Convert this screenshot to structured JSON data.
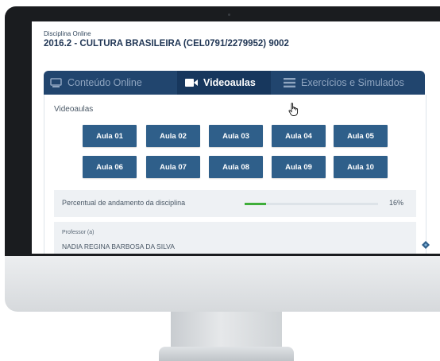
{
  "course": {
    "label": "Disciplina Online",
    "title": "2016.2 - CULTURA BRASILEIRA (CEL0791/2279952) 9002"
  },
  "tabs": [
    {
      "label": "Conteúdo Online",
      "icon": "monitor-icon",
      "active": false
    },
    {
      "label": "Videoaulas",
      "icon": "video-camera-icon",
      "active": true
    },
    {
      "label": "Exercícios e Simulados",
      "icon": "list-icon",
      "active": false
    }
  ],
  "videoaulas": {
    "section_label": "Videoaulas",
    "buttons": [
      "Aula 01",
      "Aula 02",
      "Aula 03",
      "Aula 04",
      "Aula 05",
      "Aula 06",
      "Aula 07",
      "Aula 08",
      "Aula 09",
      "Aula 10"
    ]
  },
  "progress": {
    "label": "Percentual de andamento da disciplina",
    "value_text": "16%",
    "fraction": 0.16,
    "color": "#3fae3a"
  },
  "professor": {
    "label": "Professor (a)",
    "name": "NADIA REGINA BARBOSA DA SILVA"
  },
  "colors": {
    "primary": "#21456e",
    "active_tab": "#17375d",
    "button": "#2f5f8a"
  }
}
